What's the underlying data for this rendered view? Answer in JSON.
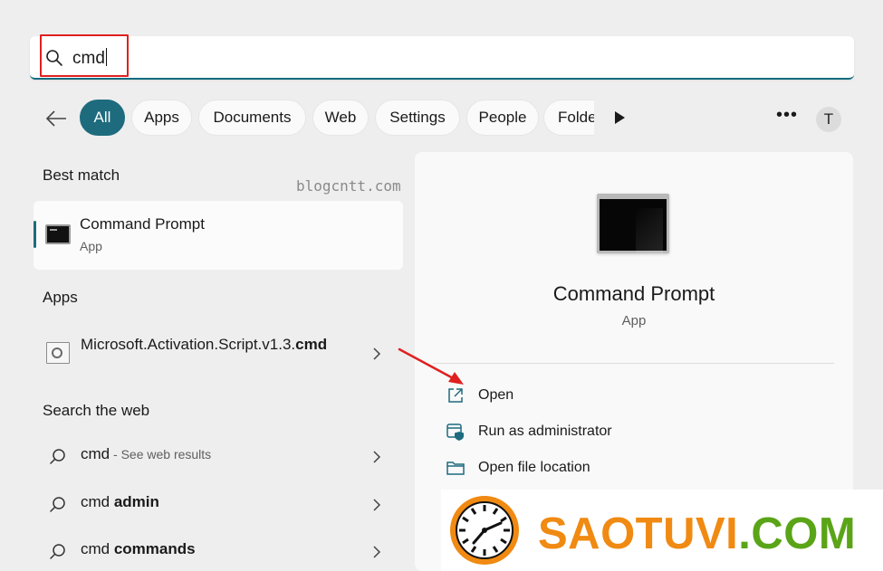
{
  "search": {
    "query": "cmd"
  },
  "filters": {
    "chips": [
      "All",
      "Apps",
      "Documents",
      "Web",
      "Settings",
      "People"
    ],
    "overflow_chip": "Folde",
    "avatar_initial": "T"
  },
  "sections": {
    "best_match": "Best match",
    "apps": "Apps",
    "search_web": "Search the web"
  },
  "watermark": "blogcntt.com",
  "best_match": {
    "name": "Command Prompt",
    "type": "App"
  },
  "apps": [
    {
      "name_prefix": "Microsoft.Activation.Script.v1.3.",
      "name_bold": "cmd"
    }
  ],
  "web_results": [
    {
      "query": "cmd",
      "suffix": " - See web results"
    },
    {
      "prefix": "cmd ",
      "bold": "admin"
    },
    {
      "prefix": "cmd ",
      "bold": "commands"
    }
  ],
  "detail": {
    "title": "Command Prompt",
    "type": "App",
    "actions": [
      "Open",
      "Run as administrator",
      "Open file location"
    ]
  },
  "banner": {
    "brand_part1": "SAOTUVI",
    "brand_part2": ".COM",
    "colors": {
      "orange": "#f08a12",
      "green": "#5aa417"
    }
  },
  "colors": {
    "accent": "#1e6b7e",
    "highlight_box": "#e02020"
  }
}
